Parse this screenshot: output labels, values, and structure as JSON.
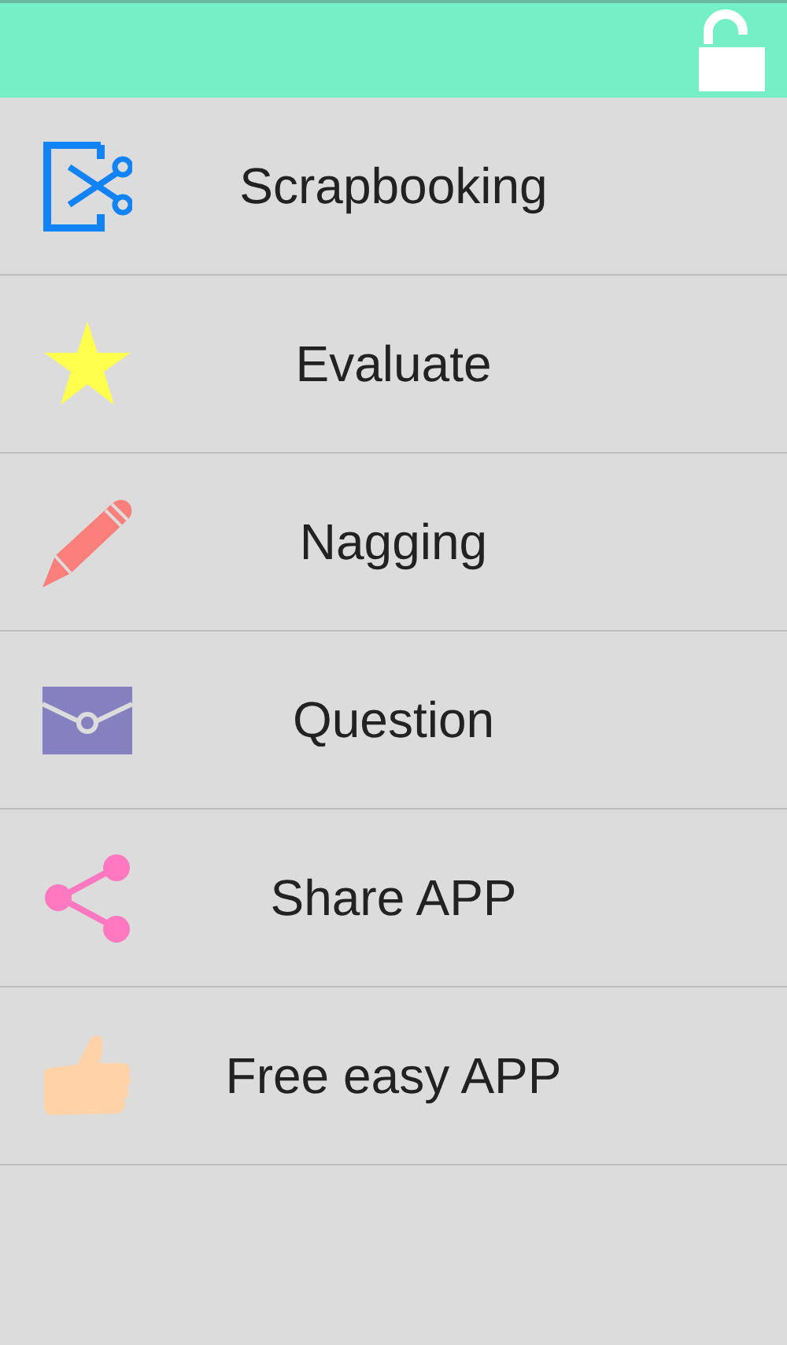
{
  "menu": [
    {
      "kind": "scissors",
      "label": "Scrapbooking"
    },
    {
      "kind": "star",
      "label": "Evaluate"
    },
    {
      "kind": "pencil",
      "label": "Nagging"
    },
    {
      "kind": "envelope",
      "label": "Question"
    },
    {
      "kind": "share",
      "label": "Share APP"
    },
    {
      "kind": "thumb",
      "label": "Free easy APP"
    }
  ]
}
